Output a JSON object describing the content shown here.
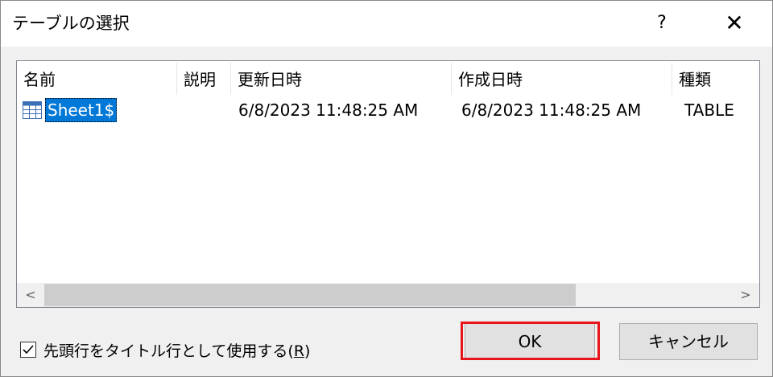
{
  "dialog": {
    "title": "テーブルの選択",
    "help_label": "?",
    "close_label": "✕"
  },
  "table": {
    "columns": [
      "名前",
      "説明",
      "更新日時",
      "作成日時",
      "種類"
    ],
    "rows": [
      {
        "name": "Sheet1$",
        "description": "",
        "modified": "6/8/2023 11:48:25 AM",
        "created": "6/8/2023 11:48:25 AM",
        "type": "TABLE"
      }
    ],
    "selected_row": 0
  },
  "scrollbar": {
    "left_arrow": "<",
    "right_arrow": ">"
  },
  "options": {
    "first_row_header_label": "先頭行をタイトル行として使用する(",
    "first_row_header_accel": "R",
    "first_row_header_suffix": ")",
    "first_row_header_checked": true
  },
  "buttons": {
    "ok_label": "OK",
    "cancel_label": "キャンセル"
  },
  "colors": {
    "selection": "#0078d7",
    "highlight_box": "#e8141b"
  },
  "icons": {
    "row_icon": "table-icon",
    "help": "help-icon",
    "close": "close-icon",
    "check": "check-icon"
  }
}
